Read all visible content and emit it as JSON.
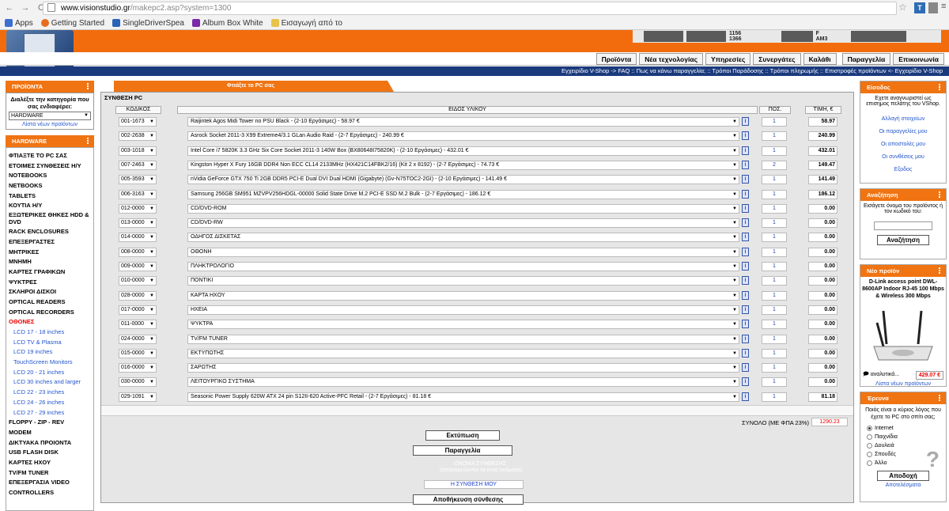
{
  "browser": {
    "url_host": "www.visionstudio.gr",
    "url_path": "/makepc2.asp?system=1300",
    "bookmarks": [
      "Apps",
      "Getting Started",
      "SingleDriverSpea",
      "Album Box White",
      "Εισαγωγή από το"
    ]
  },
  "banner": {
    "text1": "1156",
    "text2": "1366",
    "text3": "F",
    "text4": "AM3"
  },
  "topnav": [
    "Προϊόντα",
    "Νέα τεχνολογίας",
    "Υπηρεσίες",
    "Συνεργάτες",
    "Καλάθι",
    "Παραγγελία",
    "Επικοινωνία"
  ],
  "breadcrumb": "Εγχειρίδιο V-Shop -> FAQ :: Πως να κάνω παραγγελία; :: Τρόποι Παράδοσης :: Τρόποι πληρωμής :: Επιστροφές προϊόντων <- Εγχειρίδιο V-Shop",
  "left": {
    "products_title": "ΠΡΟΪΟΝΤΑ",
    "choose_label": "Διαλέξτε την κατηγορία που σας ενδιαφέρει:",
    "category_selected": "HARDWARE",
    "new_products_link": "Λίστα νέων προϊόντων",
    "hardware_title": "HARDWARE",
    "categories": [
      "ΦΤΙΑΞΤΕ ΤΟ PC ΣΑΣ",
      "ΕΤΟΙΜΕΣ ΣΥΝΘΕΣΕΙΣ Η/Υ",
      "NOTEBOOKS",
      "NETBOOKS",
      "TABLETS",
      "ΚΟΥΤΙΑ Η/Υ",
      "ΕΞΩΤΕΡΙΚΕΣ ΘΗΚΕΣ HDD & DVD",
      "RACK ENCLOSURES",
      "ΕΠΕΞΕΡΓΑΣΤΕΣ",
      "ΜΗΤΡΙΚΕΣ",
      "ΜΝΗΜΗ",
      "ΚΑΡΤΕΣ ΓΡΑΦΙΚΩΝ",
      "ΨΥΚΤΡΕΣ",
      "ΣΚΛΗΡΟΙ ΔΙΣΚΟΙ",
      "OPTICAL READERS",
      "OPTICAL RECORDERS",
      "ΟΘΟΝΕΣ",
      "LCD 17 - 18 inches",
      "LCD TV & Plasma",
      "LCD 19 inches",
      "TouchScreen Monitors",
      "LCD 20 - 21 inches",
      "LCD 30 inches and larger",
      "LCD 22 - 23 inches",
      "LCD 24 - 26 inches",
      "LCD 27 - 29 inches",
      "FLOPPY - ZIP - REV",
      "MODEM",
      "ΔΙΚΤΥΑΚΑ ΠΡΟΙΟΝΤΑ",
      "USB FLASH DISK",
      "ΚΑΡΤΕΣ ΗΧΟΥ",
      "TV/FM TUNER",
      "ΕΠΕΞΕΡΓΑΣΙΑ VIDEO",
      "CONTROLLERS"
    ]
  },
  "main": {
    "tab_title": "Φτιάξτε το PC σας",
    "section_title": "ΣΥΝΘΕΣΗ PC",
    "headers": {
      "code": "ΚΩΔΙΚΟΣ",
      "item": "ΕΙΔΟΣ ΥΛΙΚΟΥ",
      "qty": "ΠΟΣ.",
      "price": "ΤΙΜΗ, €"
    },
    "rows": [
      {
        "code": "001-1673",
        "item": "Raijintek Agos Midi Tower no PSU Black - (2-10 Εργάσιμες) - 58.97 €",
        "qty": "1",
        "price": "58.97"
      },
      {
        "code": "002-2638",
        "item": "Asrock Socket 2011-3 X99 Extreme4/3.1 GLan Audio Raid - (2-7 Εργάσιμες) - 240.99 €",
        "qty": "1",
        "price": "240.99"
      },
      {
        "code": "003-1018",
        "item": "Intel Core i7 5820K 3.3 GHz Six Core Socket 2011-3 140W Box (BX80648I75820K) - (2-10 Εργάσιμες) - 432.01 €",
        "qty": "1",
        "price": "432.01"
      },
      {
        "code": "007-2463",
        "item": "Kingston Hyper X Fury 16GB DDR4 Non ECC CL14 2133MHz (HX421C14FBK2/16) (Kit 2 x 8192) - (2-7 Εργάσιμες) - 74.73 €",
        "qty": "2",
        "price": "149.47"
      },
      {
        "code": "005-3593",
        "item": "nVidia GeForce GTX 750 Ti 2GB DDR5 PCI-E Dual DVI Dual HDMI (Gigabyte) (Gv-N75TOC2-2GI) - (2-10 Εργάσιμες) - 141.49 €",
        "qty": "1",
        "price": "141.49"
      },
      {
        "code": "006-3163",
        "item": "Samsung 256GB SM951 MZVPV256HDGL-00000 Solid State Drive M.2 PCI-E SSD M.2 Bulk - (2-7 Εργάσιμες) - 186.12 €",
        "qty": "1",
        "price": "186.12"
      },
      {
        "code": "012-0000",
        "item": "CD/DVD-ROM",
        "qty": "1",
        "price": "0.00"
      },
      {
        "code": "013-0000",
        "item": "CD/DVD-RW",
        "qty": "1",
        "price": "0.00"
      },
      {
        "code": "014-0000",
        "item": "ΟΔΗΓΟΣ ΔΙΣΚΕΤΑΣ",
        "qty": "1",
        "price": "0.00"
      },
      {
        "code": "008-0000",
        "item": "ΟΘΟΝΗ",
        "qty": "1",
        "price": "0.00"
      },
      {
        "code": "009-0000",
        "item": "ΠΛΗΚΤΡΟΛΟΓΙΟ",
        "qty": "1",
        "price": "0.00"
      },
      {
        "code": "010-0000",
        "item": "ΠΟΝΤΙΚΙ",
        "qty": "1",
        "price": "0.00"
      },
      {
        "code": "028-0000",
        "item": "ΚΑΡΤΑ ΗΧΟΥ",
        "qty": "1",
        "price": "0.00"
      },
      {
        "code": "017-0000",
        "item": "ΗΧΕΙΑ",
        "qty": "1",
        "price": "0.00"
      },
      {
        "code": "011-0000",
        "item": "ΨΥΚΤΡΑ",
        "qty": "1",
        "price": "0.00"
      },
      {
        "code": "024-0000",
        "item": "TV/FM TUNER",
        "qty": "1",
        "price": "0.00"
      },
      {
        "code": "015-0000",
        "item": "ΕΚΤΥΠΩΤΗΣ",
        "qty": "1",
        "price": "0.00"
      },
      {
        "code": "016-0000",
        "item": "ΣΑΡΩΤΗΣ",
        "qty": "1",
        "price": "0.00"
      },
      {
        "code": "030-0000",
        "item": "ΛΕΙΤΟΥΡΓΙΚΟ ΣΥΣΤΗΜΑ",
        "qty": "1",
        "price": "0.00"
      },
      {
        "code": "029-1091",
        "item": "Seasonic Power Supply 620W ATX 24 pin S12II-620 Active-PFC Retail - (2-7 Εργάσιμες) - 81.18 €",
        "qty": "1",
        "price": "81.18"
      }
    ],
    "total_label": "ΣΥΝΟΛΟ (ΜΕ ΦΠΑ 23%)",
    "total_value": "1290.23",
    "print_btn": "Εκτύπωση",
    "order_btn": "Παραγγελία",
    "name_label": "ΟΝΟΜΑ ΣΥΝΘΕΣΗΣ:",
    "name_hint": "(απαγορεύονται τα κενά ονόματα)",
    "name_value": "Η ΣΥΝΘΕΣΗ ΜΟΥ",
    "save_btn": "Αποθήκευση σύνθεσης"
  },
  "right": {
    "login_title": "Είσοδος",
    "login_text": "Εχετε αναγνωριστεί ως επισημος πελάτης του VShop.",
    "links": [
      "Αλλαγή στοιχείων",
      "Οι παραγγελίες μου",
      "Οι αποστολές μου",
      "Οι συνθέσεις μου",
      "Εξοδος"
    ],
    "search_title": "Αναζήτηση",
    "search_text": "Εισάγετε όνομα του προϊόντος ή τον κωδικό του:",
    "search_btn": "Αναζήτηση",
    "new_title": "Νέο προϊόν",
    "new_name": "D-Link access point DWL-8600AP Indoor RJ-45 100 Mbps & Wireless 300 Mbps",
    "new_more": "αναλυτικά...",
    "new_price": "429.07 €",
    "new_list": "Λίστα νέων προϊόντων",
    "poll_title": "Έρευνα",
    "poll_question": "Ποιός είναι ο κύριος λόγος που έχετε το PC στο σπίτι σας;",
    "poll_options": [
      "Internet",
      "Παιχνίδια",
      "Δουλειά",
      "Σπουδές",
      "Άλλο"
    ],
    "poll_btn": "Αποδοχή",
    "poll_results": "Αποτελέσματα"
  }
}
